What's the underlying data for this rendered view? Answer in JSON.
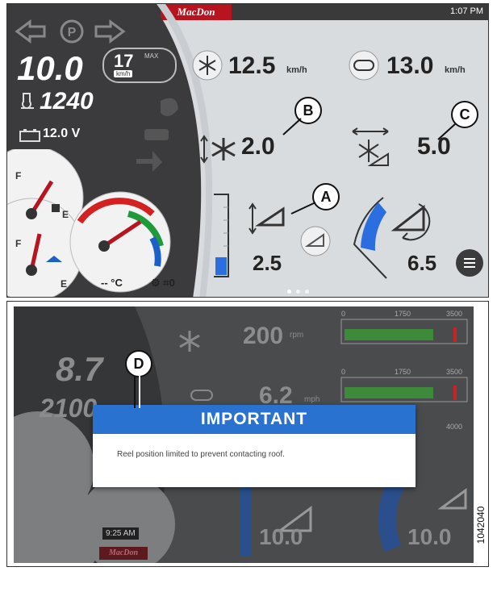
{
  "top": {
    "brand": "MacDon",
    "time": "1:07 PM",
    "speed": "10.0",
    "max_speed": "17",
    "max_label": "MAX",
    "max_unit": "km/h",
    "rpm": "1240",
    "voltage": "12.0 V",
    "fuel_full": "F",
    "fuel_empty": "E",
    "def_full": "F",
    "def_empty": "E",
    "temp_label": "-- °C",
    "gear": "0",
    "ground_speed": "12.5",
    "ground_unit": "km/h",
    "reel_speed_kmh": "13.0",
    "reel_unit": "km/h",
    "reel_height": "2.0",
    "reel_fore_aft": "5.0",
    "header_height": "2.5",
    "header_tilt": "6.5",
    "callout_a": "A",
    "callout_b": "B",
    "callout_c": "C"
  },
  "bottom": {
    "speed": "8.7",
    "rpm": "2100",
    "reel_rpm": "200",
    "reel_rpm_unit": "rpm",
    "reel_row_speed": "6.2",
    "row_speed_unit": "mph",
    "scale1": [
      "0",
      "1750",
      "3500"
    ],
    "scale2": [
      "0",
      "1750",
      "3500"
    ],
    "scale3": [
      "4000"
    ],
    "time": "9:25 AM",
    "brand": "MacDon",
    "left_val": "10.0",
    "right_val": "10.0",
    "dialog_title": "IMPORTANT",
    "dialog_message": "Reel position limited to prevent contacting roof.",
    "callout_d": "D",
    "figure_id": "1042040"
  }
}
